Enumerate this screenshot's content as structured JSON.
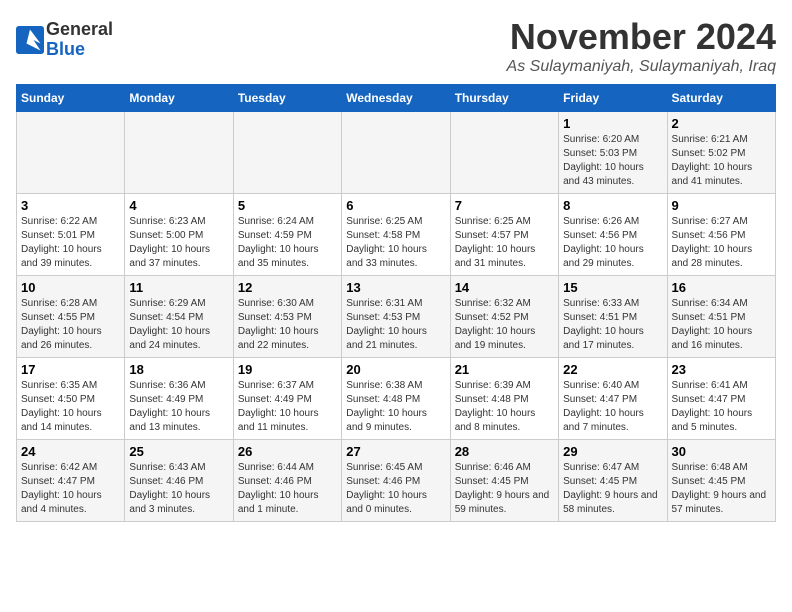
{
  "logo": {
    "line1": "General",
    "line2": "Blue"
  },
  "title": "November 2024",
  "location": "As Sulaymaniyah, Sulaymaniyah, Iraq",
  "weekdays": [
    "Sunday",
    "Monday",
    "Tuesday",
    "Wednesday",
    "Thursday",
    "Friday",
    "Saturday"
  ],
  "rows": [
    [
      {
        "day": "",
        "info": ""
      },
      {
        "day": "",
        "info": ""
      },
      {
        "day": "",
        "info": ""
      },
      {
        "day": "",
        "info": ""
      },
      {
        "day": "",
        "info": ""
      },
      {
        "day": "1",
        "info": "Sunrise: 6:20 AM\nSunset: 5:03 PM\nDaylight: 10 hours and 43 minutes."
      },
      {
        "day": "2",
        "info": "Sunrise: 6:21 AM\nSunset: 5:02 PM\nDaylight: 10 hours and 41 minutes."
      }
    ],
    [
      {
        "day": "3",
        "info": "Sunrise: 6:22 AM\nSunset: 5:01 PM\nDaylight: 10 hours and 39 minutes."
      },
      {
        "day": "4",
        "info": "Sunrise: 6:23 AM\nSunset: 5:00 PM\nDaylight: 10 hours and 37 minutes."
      },
      {
        "day": "5",
        "info": "Sunrise: 6:24 AM\nSunset: 4:59 PM\nDaylight: 10 hours and 35 minutes."
      },
      {
        "day": "6",
        "info": "Sunrise: 6:25 AM\nSunset: 4:58 PM\nDaylight: 10 hours and 33 minutes."
      },
      {
        "day": "7",
        "info": "Sunrise: 6:25 AM\nSunset: 4:57 PM\nDaylight: 10 hours and 31 minutes."
      },
      {
        "day": "8",
        "info": "Sunrise: 6:26 AM\nSunset: 4:56 PM\nDaylight: 10 hours and 29 minutes."
      },
      {
        "day": "9",
        "info": "Sunrise: 6:27 AM\nSunset: 4:56 PM\nDaylight: 10 hours and 28 minutes."
      }
    ],
    [
      {
        "day": "10",
        "info": "Sunrise: 6:28 AM\nSunset: 4:55 PM\nDaylight: 10 hours and 26 minutes."
      },
      {
        "day": "11",
        "info": "Sunrise: 6:29 AM\nSunset: 4:54 PM\nDaylight: 10 hours and 24 minutes."
      },
      {
        "day": "12",
        "info": "Sunrise: 6:30 AM\nSunset: 4:53 PM\nDaylight: 10 hours and 22 minutes."
      },
      {
        "day": "13",
        "info": "Sunrise: 6:31 AM\nSunset: 4:53 PM\nDaylight: 10 hours and 21 minutes."
      },
      {
        "day": "14",
        "info": "Sunrise: 6:32 AM\nSunset: 4:52 PM\nDaylight: 10 hours and 19 minutes."
      },
      {
        "day": "15",
        "info": "Sunrise: 6:33 AM\nSunset: 4:51 PM\nDaylight: 10 hours and 17 minutes."
      },
      {
        "day": "16",
        "info": "Sunrise: 6:34 AM\nSunset: 4:51 PM\nDaylight: 10 hours and 16 minutes."
      }
    ],
    [
      {
        "day": "17",
        "info": "Sunrise: 6:35 AM\nSunset: 4:50 PM\nDaylight: 10 hours and 14 minutes."
      },
      {
        "day": "18",
        "info": "Sunrise: 6:36 AM\nSunset: 4:49 PM\nDaylight: 10 hours and 13 minutes."
      },
      {
        "day": "19",
        "info": "Sunrise: 6:37 AM\nSunset: 4:49 PM\nDaylight: 10 hours and 11 minutes."
      },
      {
        "day": "20",
        "info": "Sunrise: 6:38 AM\nSunset: 4:48 PM\nDaylight: 10 hours and 9 minutes."
      },
      {
        "day": "21",
        "info": "Sunrise: 6:39 AM\nSunset: 4:48 PM\nDaylight: 10 hours and 8 minutes."
      },
      {
        "day": "22",
        "info": "Sunrise: 6:40 AM\nSunset: 4:47 PM\nDaylight: 10 hours and 7 minutes."
      },
      {
        "day": "23",
        "info": "Sunrise: 6:41 AM\nSunset: 4:47 PM\nDaylight: 10 hours and 5 minutes."
      }
    ],
    [
      {
        "day": "24",
        "info": "Sunrise: 6:42 AM\nSunset: 4:47 PM\nDaylight: 10 hours and 4 minutes."
      },
      {
        "day": "25",
        "info": "Sunrise: 6:43 AM\nSunset: 4:46 PM\nDaylight: 10 hours and 3 minutes."
      },
      {
        "day": "26",
        "info": "Sunrise: 6:44 AM\nSunset: 4:46 PM\nDaylight: 10 hours and 1 minute."
      },
      {
        "day": "27",
        "info": "Sunrise: 6:45 AM\nSunset: 4:46 PM\nDaylight: 10 hours and 0 minutes."
      },
      {
        "day": "28",
        "info": "Sunrise: 6:46 AM\nSunset: 4:45 PM\nDaylight: 9 hours and 59 minutes."
      },
      {
        "day": "29",
        "info": "Sunrise: 6:47 AM\nSunset: 4:45 PM\nDaylight: 9 hours and 58 minutes."
      },
      {
        "day": "30",
        "info": "Sunrise: 6:48 AM\nSunset: 4:45 PM\nDaylight: 9 hours and 57 minutes."
      }
    ]
  ]
}
